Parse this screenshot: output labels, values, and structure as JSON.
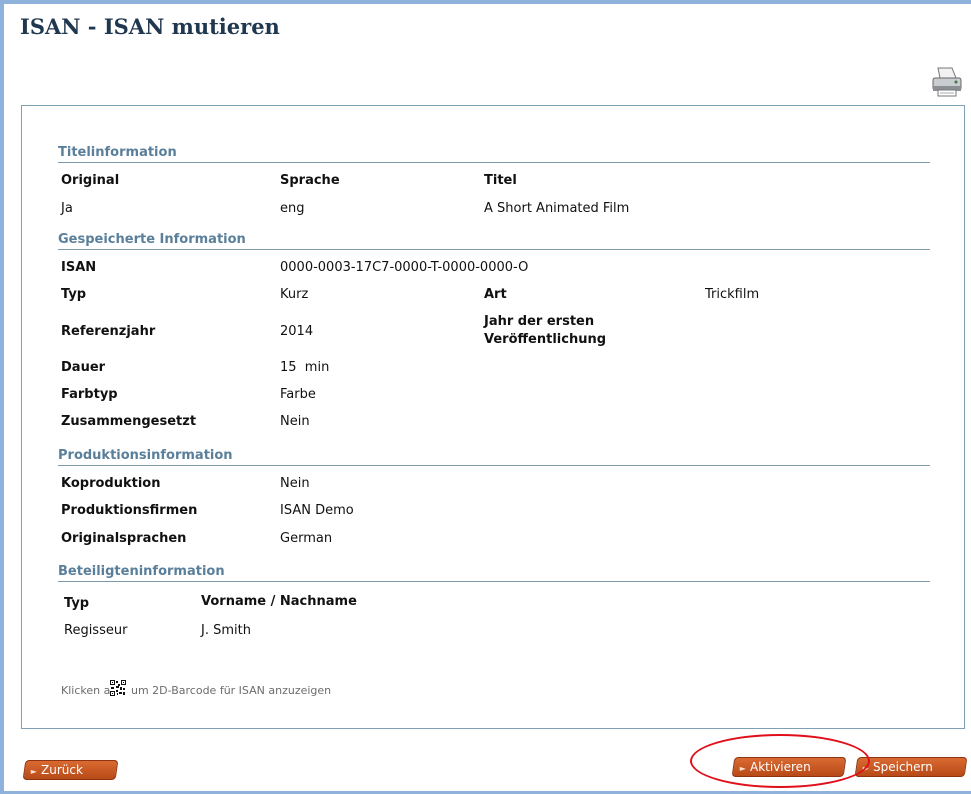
{
  "page": {
    "title": "ISAN - ISAN mutieren"
  },
  "icons": {
    "print": "printer-icon",
    "barcode": "qr-code-icon",
    "arrow": "arrow-right-icon"
  },
  "colors": {
    "section_heading": "#5a7f9a",
    "button": "#c85a22",
    "highlight": "#e0101a"
  },
  "sections": {
    "title_info": "Titelinformation",
    "saved_info": "Gespeicherte Information",
    "production_info": "Produktionsinformation",
    "participants_info": "Beteiligteninformation"
  },
  "title_info": {
    "headers": {
      "original": "Original",
      "language": "Sprache",
      "title": "Titel"
    },
    "row": {
      "original": "Ja",
      "language": "eng",
      "title": "A Short Animated Film"
    }
  },
  "saved_info": {
    "isan_label": "ISAN",
    "isan_value": "0000-0003-17C7-0000-T-0000-0000-O",
    "type_label": "Typ",
    "type_value": "Kurz",
    "kind_label": "Art",
    "kind_value": "Trickfilm",
    "refyear_label": "Referenzjahr",
    "refyear_value": "2014",
    "firstpub_label_1": "Jahr der ersten",
    "firstpub_label_2": "Veröffentlichung",
    "duration_label": "Dauer",
    "duration_value": "15  min",
    "color_label": "Farbtyp",
    "color_value": "Farbe",
    "composite_label": "Zusammengesetzt",
    "composite_value": "Nein"
  },
  "production_info": {
    "coprod_label": "Koproduktion",
    "coprod_value": "Nein",
    "companies_label": "Produktionsfirmen",
    "companies_value": "ISAN Demo",
    "languages_label": "Originalsprachen",
    "languages_value": "German"
  },
  "participants": {
    "headers": {
      "type": "Typ",
      "name": "Vorname / Nachname"
    },
    "rows": [
      {
        "type": "Regisseur",
        "name": "J. Smith"
      }
    ]
  },
  "barcode_hint": {
    "before": "Klicken auf",
    "after": "um 2D-Barcode für ISAN anzuzeigen"
  },
  "buttons": {
    "back": "Zurück",
    "activate": "Aktivieren",
    "save": "Speichern"
  }
}
